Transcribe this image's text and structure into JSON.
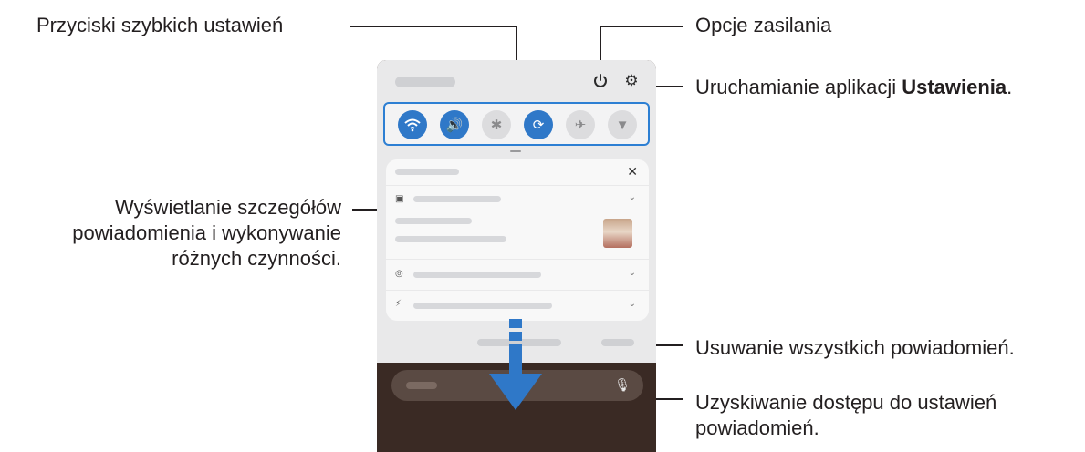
{
  "callouts": {
    "quick_settings": "Przyciski szybkich ustawień",
    "power_options": "Opcje zasilania",
    "settings_prefix": "Uruchamianie aplikacji ",
    "settings_bold": "Ustawienia",
    "settings_suffix": ".",
    "notification_details_line1": "Wyświetlanie szczegółów",
    "notification_details_line2": "powiadomienia i wykonywanie",
    "notification_details_line3": "różnych czynności.",
    "clear_all": "Usuwanie wszystkich powiadomień.",
    "notification_settings_line1": "Uzyskiwanie dostępu do ustawień",
    "notification_settings_line2": "powiadomień."
  },
  "quick_settings": [
    {
      "name": "wifi",
      "state": "on",
      "icon": "wifi-icon"
    },
    {
      "name": "sound",
      "state": "on",
      "icon": "volume-icon"
    },
    {
      "name": "bluetooth",
      "state": "off",
      "icon": "bluetooth-icon"
    },
    {
      "name": "auto-rotate",
      "state": "on",
      "icon": "rotate-icon"
    },
    {
      "name": "airplane",
      "state": "off",
      "icon": "airplane-icon"
    },
    {
      "name": "flashlight",
      "state": "off",
      "icon": "flashlight-icon"
    }
  ],
  "colors": {
    "accent": "#2f78c8",
    "outline": "#2d7fd3",
    "text": "#231f20",
    "panel": "#e9e9ea",
    "wallpaper": "#3a2a24"
  }
}
